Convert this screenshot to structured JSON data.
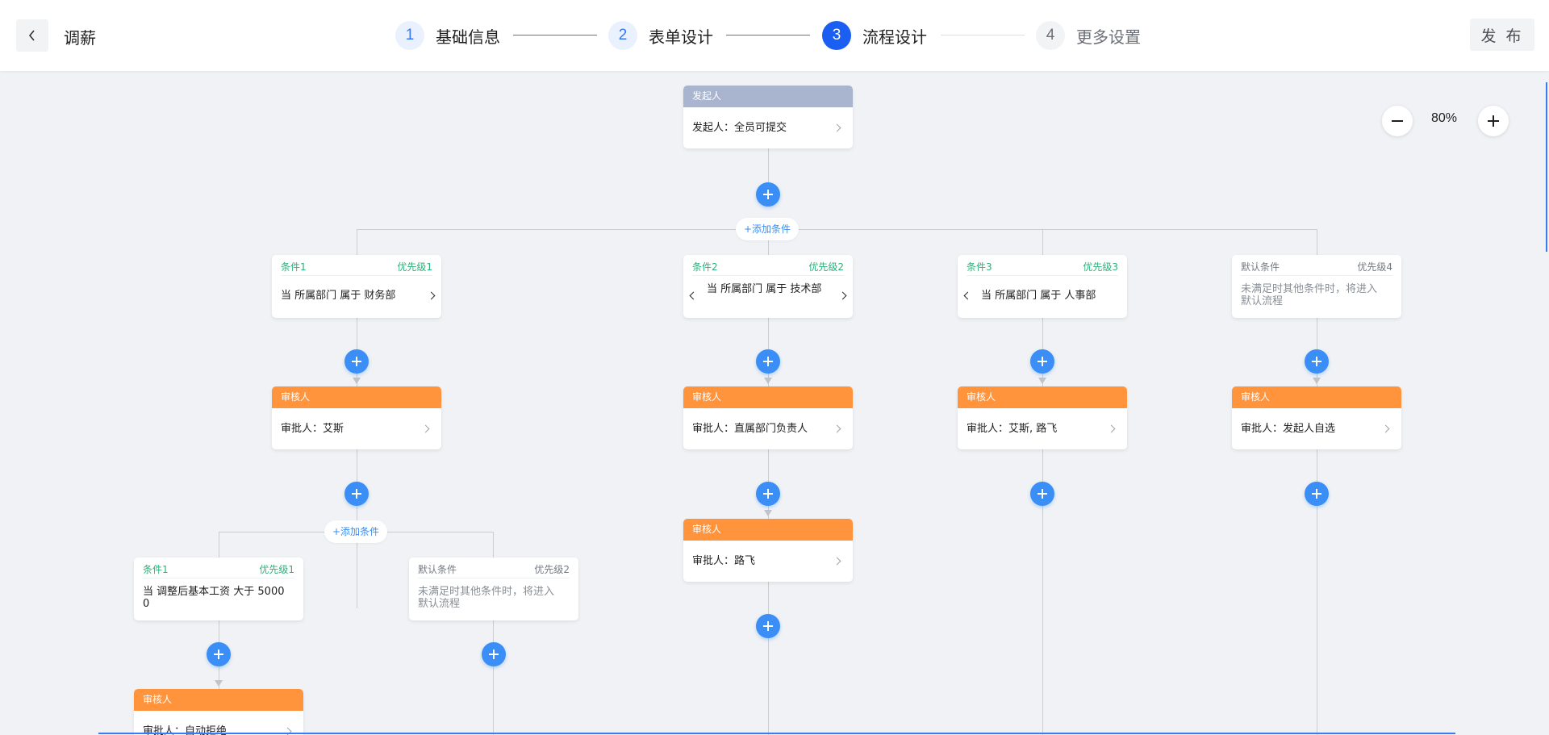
{
  "header": {
    "title": "调薪",
    "steps": [
      {
        "num": "1",
        "label": "基础信息"
      },
      {
        "num": "2",
        "label": "表单设计"
      },
      {
        "num": "3",
        "label": "流程设计"
      },
      {
        "num": "4",
        "label": "更多设置"
      }
    ],
    "active_step": 3,
    "publish_label": "发 布"
  },
  "zoom": {
    "value": "80%"
  },
  "flow": {
    "initiator": {
      "title": "发起人",
      "content": "发起人：全员可提交"
    },
    "add_condition_label": "+添加条件",
    "branches": [
      {
        "condition": {
          "name": "条件1",
          "priority": "优先级1",
          "text": "当 所属部门 属于 财务部"
        },
        "approver": {
          "title": "审核人",
          "content": "审批人：艾斯"
        },
        "sub_branches": [
          {
            "condition": {
              "name": "条件1",
              "priority": "优先级1",
              "text": "当 调整后基本工资 大于 50000"
            },
            "approver": {
              "title": "审核人",
              "content": "审批人：自动拒绝"
            }
          },
          {
            "condition": {
              "name": "默认条件",
              "priority": "优先级2",
              "text": "未满足时其他条件时，将进入默认流程"
            }
          }
        ]
      },
      {
        "condition": {
          "name": "条件2",
          "priority": "优先级2",
          "text": "当 所属部门 属于 技术部"
        },
        "approvers": [
          {
            "title": "审核人",
            "content": "审批人：直属部门负责人"
          },
          {
            "title": "审核人",
            "content": "审批人：路飞"
          }
        ]
      },
      {
        "condition": {
          "name": "条件3",
          "priority": "优先级3",
          "text": "当 所属部门 属于 人事部"
        },
        "approver": {
          "title": "审核人",
          "content": "审批人：艾斯, 路飞"
        }
      },
      {
        "condition": {
          "name": "默认条件",
          "priority": "优先级4",
          "text": "未满足时其他条件时，将进入默认流程"
        },
        "approver": {
          "title": "审核人",
          "content": "审批人：发起人自选"
        }
      }
    ]
  },
  "colors": {
    "primary": "#3a8ef6",
    "step_active": "#1a5ff2",
    "approver_header": "#ff943d",
    "initiator_header": "#a9b5ce",
    "condition_green": "#2bb27a",
    "canvas_bg": "#f0f2f5"
  },
  "icons": {
    "back": "chevron-left-icon",
    "add": "plus-icon",
    "zoom_out": "minus-icon",
    "zoom_in": "plus-icon",
    "node_arrow": "chevron-right-icon"
  }
}
